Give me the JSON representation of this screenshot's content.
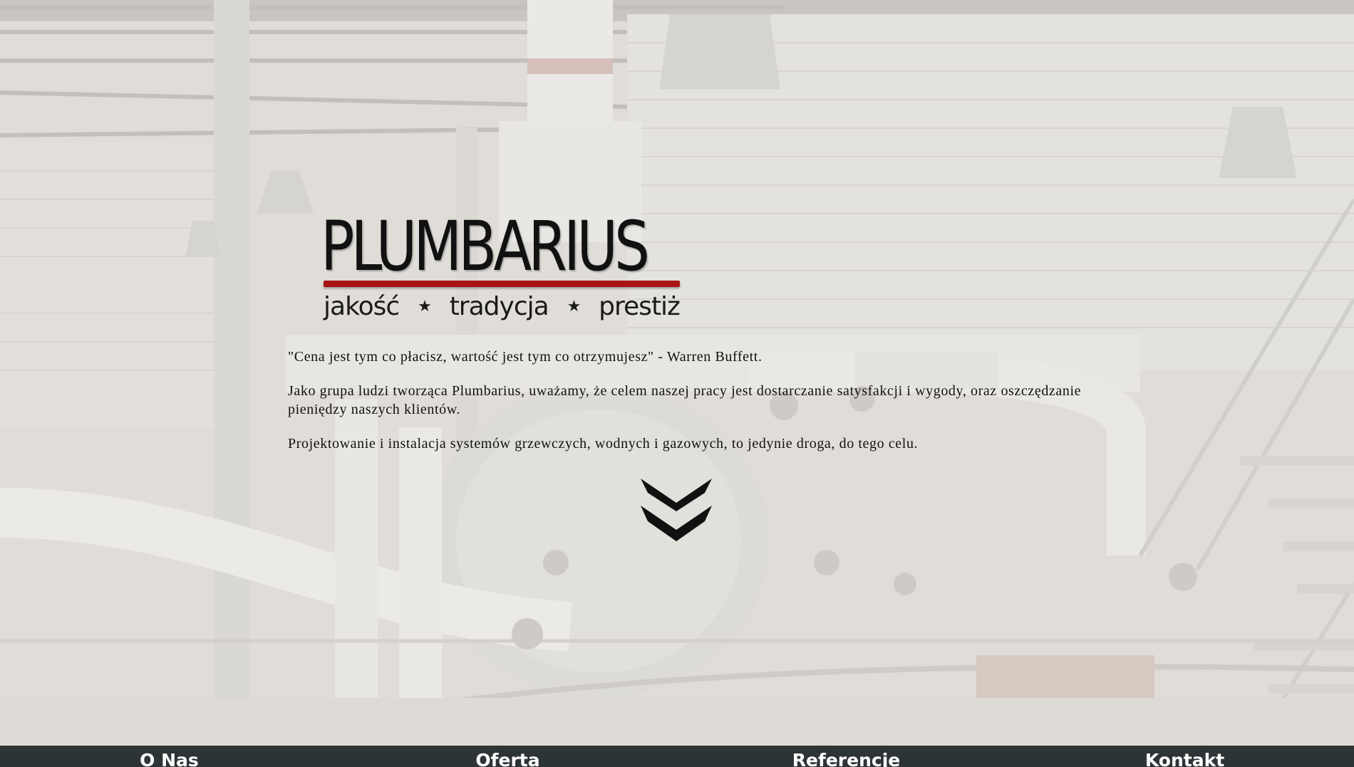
{
  "brand": {
    "wordmark": "PLUMBARIUS",
    "tagline": [
      "jakość",
      "tradycja",
      "prestiż"
    ],
    "accent_color": "#a81414"
  },
  "intro": {
    "quote": "\"Cena jest tym co płacisz, wartość jest tym co otrzymujesz\" - Warren Buffett.",
    "paragraph_1": "Jako grupa ludzi tworząca Plumbarius, uważamy, że celem naszej pracy jest dostarczanie satysfakcji i wygody, oraz oszczędzanie pieniędzy naszych klientów.",
    "paragraph_2": "Projektowanie i instalacja systemów grzewczych, wodnych i gazowych, to jedynie droga, do tego celu."
  },
  "scroll_icon": "double-chevron-down-icon",
  "nav": {
    "background": "#2d3436",
    "items": [
      {
        "label": "O Nas"
      },
      {
        "label": "Oferta"
      },
      {
        "label": "Referencje"
      },
      {
        "label": "Kontakt"
      }
    ]
  }
}
